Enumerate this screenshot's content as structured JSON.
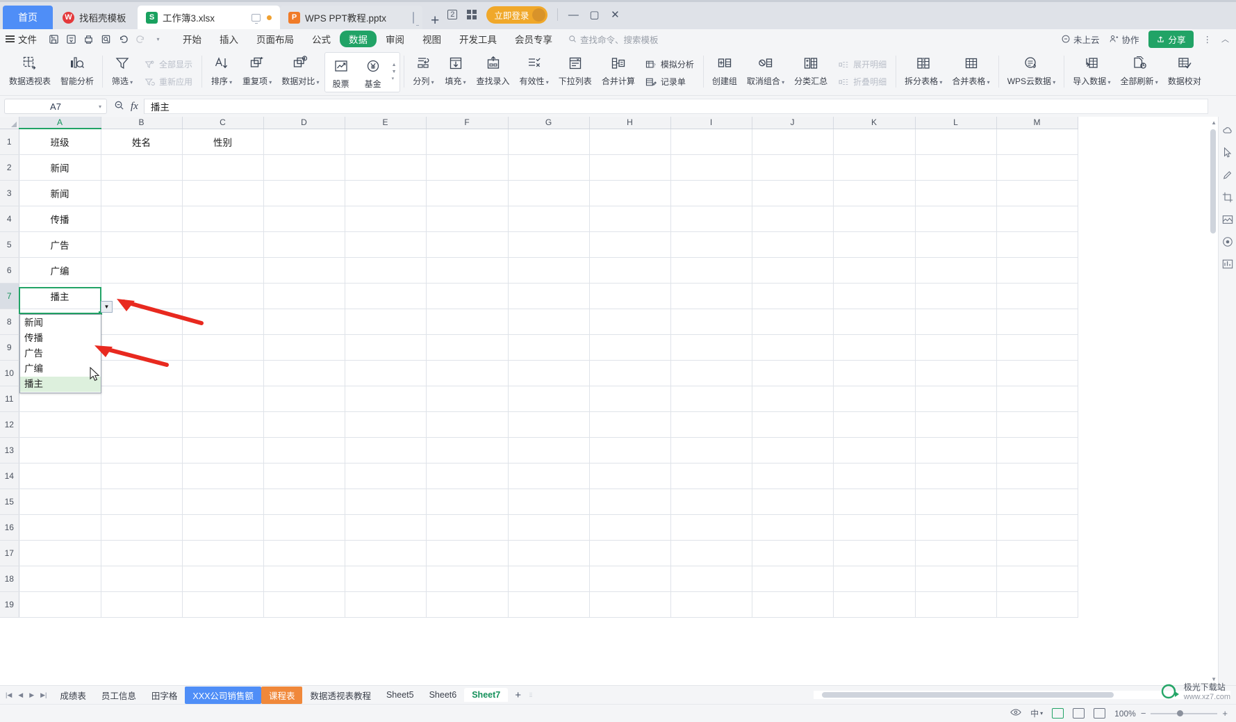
{
  "window": {
    "tabs": [
      {
        "label": "首页",
        "type": "home"
      },
      {
        "label": "找稻壳模板",
        "type": "doc",
        "icon": "docer-icon",
        "state": "inactive"
      },
      {
        "label": "工作簿3.xlsx",
        "type": "doc",
        "icon": "excel-icon",
        "state": "active"
      },
      {
        "label": "WPS PPT教程.pptx",
        "type": "doc",
        "icon": "ppt-icon",
        "state": "inactive"
      }
    ],
    "new_tab_label": "+",
    "badge_label": "2",
    "login_label": "立即登录",
    "minimize": "—",
    "maximize": "▢",
    "close": "✕"
  },
  "menubar": {
    "file_label": "文件",
    "quick_icons": [
      "save-icon",
      "save-cloud-icon",
      "print-icon",
      "print-preview-icon",
      "undo-icon",
      "redo-icon",
      "customize-qat-icon"
    ],
    "tabs": [
      {
        "label": "开始",
        "active": false
      },
      {
        "label": "插入",
        "active": false
      },
      {
        "label": "页面布局",
        "active": false
      },
      {
        "label": "公式",
        "active": false
      },
      {
        "label": "数据",
        "active": true
      },
      {
        "label": "审阅",
        "active": false
      },
      {
        "label": "视图",
        "active": false
      },
      {
        "label": "开发工具",
        "active": false
      },
      {
        "label": "会员专享",
        "active": false
      }
    ],
    "search_placeholder": "查找命令、搜索模板",
    "right": {
      "cloud_label": "未上云",
      "collab_label": "协作",
      "share_label": "分享",
      "more_label": "⋮",
      "collapse_label": "︿"
    },
    "accent_color": "#21a366"
  },
  "ribbon": {
    "groups": [
      {
        "items": [
          {
            "label": "数据透视表",
            "icon": "pivot-table-icon",
            "caret": false
          },
          {
            "label": "智能分析",
            "icon": "smart-analysis-icon",
            "caret": false
          }
        ]
      },
      {
        "items": [
          {
            "label": "筛选",
            "icon": "filter-icon",
            "caret": true
          }
        ],
        "stack": [
          {
            "label": "全部显示",
            "icon": "show-all-icon",
            "disabled": true
          },
          {
            "label": "重新应用",
            "icon": "reapply-icon",
            "disabled": true
          }
        ]
      },
      {
        "items": [
          {
            "label": "排序",
            "icon": "sort-icon",
            "caret": true
          },
          {
            "label": "重复项",
            "icon": "duplicates-icon",
            "caret": true
          },
          {
            "label": "数据对比",
            "icon": "data-compare-icon",
            "caret": true
          }
        ]
      },
      {
        "boxed": true,
        "items": [
          {
            "label": "股票",
            "icon": "stock-icon",
            "caret": false
          },
          {
            "label": "基金",
            "icon": "fund-icon",
            "caret": false
          }
        ]
      },
      {
        "items": [
          {
            "label": "分列",
            "icon": "text-to-columns-icon",
            "caret": true
          },
          {
            "label": "填充",
            "icon": "fill-icon",
            "caret": true
          },
          {
            "label": "查找录入",
            "icon": "lookup-entry-icon",
            "caret": false
          },
          {
            "label": "有效性",
            "icon": "validation-icon",
            "caret": true
          },
          {
            "label": "下拉列表",
            "icon": "dropdown-list-icon",
            "caret": false
          },
          {
            "label": "合并计算",
            "icon": "consolidate-icon",
            "caret": false
          }
        ],
        "stack": [
          {
            "label": "模拟分析",
            "icon": "what-if-icon",
            "disabled": false
          },
          {
            "label": "记录单",
            "icon": "record-form-icon",
            "disabled": false
          }
        ]
      },
      {
        "items": [
          {
            "label": "创建组",
            "icon": "group-icon",
            "caret": false
          },
          {
            "label": "取消组合",
            "icon": "ungroup-icon",
            "caret": true
          },
          {
            "label": "分类汇总",
            "icon": "subtotal-icon",
            "caret": false
          }
        ],
        "stack": [
          {
            "label": "展开明细",
            "icon": "expand-detail-icon",
            "disabled": true
          },
          {
            "label": "折叠明细",
            "icon": "collapse-detail-icon",
            "disabled": true
          }
        ]
      },
      {
        "items": [
          {
            "label": "拆分表格",
            "icon": "split-table-icon",
            "caret": true
          },
          {
            "label": "合并表格",
            "icon": "merge-table-icon",
            "caret": true
          }
        ]
      },
      {
        "items": [
          {
            "label": "WPS云数据",
            "icon": "wps-cloud-data-icon",
            "caret": true
          }
        ]
      },
      {
        "items": [
          {
            "label": "导入数据",
            "icon": "import-data-icon",
            "caret": true
          },
          {
            "label": "全部刷新",
            "icon": "refresh-all-icon",
            "caret": true
          },
          {
            "label": "数据校对",
            "icon": "data-proofread-icon",
            "caret": false
          }
        ]
      }
    ]
  },
  "formula_bar": {
    "name_box_value": "A7",
    "name_box_caret": "▾",
    "zoom_icon": "zoom-out-icon",
    "fx_label": "fx",
    "content": "播主"
  },
  "sheet": {
    "columns": [
      "A",
      "B",
      "C",
      "D",
      "E",
      "F",
      "G",
      "H",
      "I",
      "J",
      "K",
      "L",
      "M"
    ],
    "selected_column": "A",
    "rows": [
      "1",
      "2",
      "3",
      "4",
      "5",
      "6",
      "7",
      "8",
      "9",
      "10",
      "11",
      "12",
      "13",
      "14",
      "15",
      "16",
      "17",
      "18",
      "19"
    ],
    "selected_row": "7",
    "data": {
      "1": {
        "A": "班级",
        "B": "姓名",
        "C": "性别"
      },
      "2": {
        "A": "新闻"
      },
      "3": {
        "A": "新闻"
      },
      "4": {
        "A": "传播"
      },
      "5": {
        "A": "广告"
      },
      "6": {
        "A": "广编"
      },
      "7": {
        "A": "播主"
      }
    },
    "selected_cell": "A7",
    "dropdown": {
      "button_glyph": "▼",
      "items": [
        {
          "label": "新闻",
          "highlighted": false
        },
        {
          "label": "传播",
          "highlighted": false
        },
        {
          "label": "广告",
          "highlighted": false
        },
        {
          "label": "广编",
          "highlighted": false
        },
        {
          "label": "播主",
          "highlighted": true
        }
      ]
    }
  },
  "right_toolbar": {
    "items": [
      "cloud-sync-icon",
      "pointer-icon",
      "pen-icon",
      "crop-icon",
      "picture-icon",
      "record-icon",
      "chart-icon"
    ]
  },
  "sheet_tabs": {
    "nav": [
      "first-sheet-icon",
      "prev-sheet-icon",
      "next-sheet-icon",
      "last-sheet-icon"
    ],
    "items": [
      {
        "label": "成绩表",
        "style": "normal"
      },
      {
        "label": "员工信息",
        "style": "normal"
      },
      {
        "label": "田字格",
        "style": "normal"
      },
      {
        "label": "XXX公司销售额",
        "style": "blue"
      },
      {
        "label": "课程表",
        "style": "orange"
      },
      {
        "label": "数据透视表教程",
        "style": "normal"
      },
      {
        "label": "Sheet5",
        "style": "normal"
      },
      {
        "label": "Sheet6",
        "style": "normal"
      },
      {
        "label": "Sheet7",
        "style": "active"
      }
    ],
    "add_label": "+"
  },
  "statusbar": {
    "view_icons": [
      "eye-icon",
      "ime-icon",
      "normal-view-icon",
      "page-layout-icon",
      "page-break-icon"
    ],
    "zoom_value": "100%",
    "zoom_minus": "−",
    "zoom_plus": "+"
  },
  "watermark": {
    "line1": "极光下载站",
    "line2": "www.xz7.com"
  },
  "colors": {
    "accent_green": "#21a366",
    "tab_blue": "#4f8ef7",
    "login_orange": "#f0a82a",
    "arrow_red": "#e8291f"
  }
}
